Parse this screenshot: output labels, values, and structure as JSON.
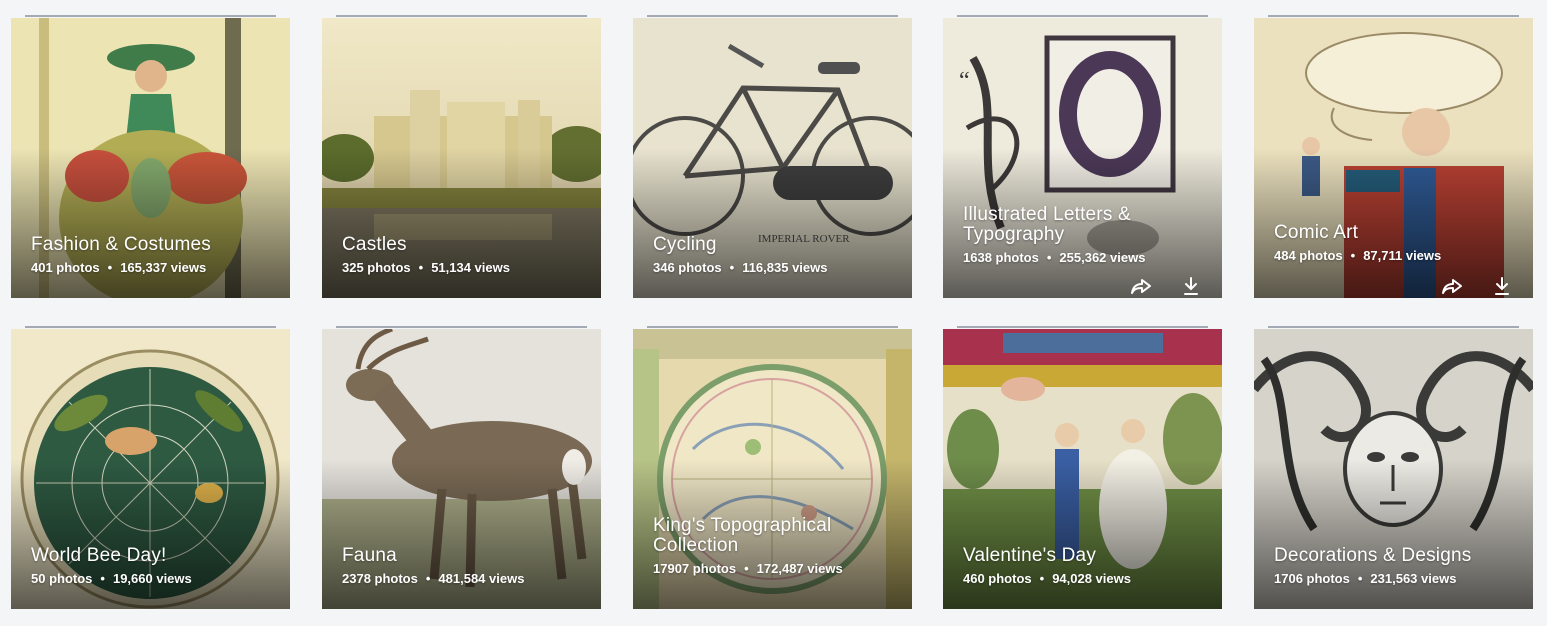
{
  "albums": [
    {
      "title": "Fashion & Costumes",
      "photos": "401 photos",
      "views": "165,337 views"
    },
    {
      "title": "Castles",
      "photos": "325 photos",
      "views": "51,134 views"
    },
    {
      "title": "Cycling",
      "photos": "346 photos",
      "views": "116,835 views"
    },
    {
      "title": "Illustrated Letters & Typography",
      "photos": "1638 photos",
      "views": "255,362 views"
    },
    {
      "title": "Comic Art",
      "photos": "484 photos",
      "views": "87,711 views"
    },
    {
      "title": "World Bee Day!",
      "photos": "50 photos",
      "views": "19,660 views"
    },
    {
      "title": "Fauna",
      "photos": "2378 photos",
      "views": "481,584 views"
    },
    {
      "title": "King's Topographical Collection",
      "photos": "17907 photos",
      "views": "172,487 views"
    },
    {
      "title": "Valentine's Day",
      "photos": "460 photos",
      "views": "94,028 views"
    },
    {
      "title": "Decorations & Designs",
      "photos": "1706 photos",
      "views": "231,563 views"
    }
  ],
  "separator": "•",
  "action_icons": [
    "share-icon",
    "download-icon"
  ]
}
